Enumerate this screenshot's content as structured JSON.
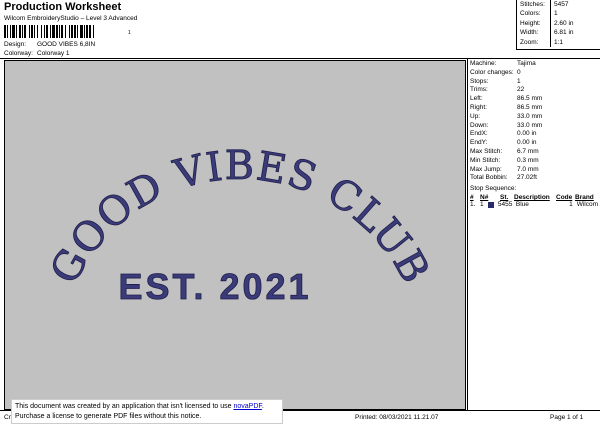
{
  "header": {
    "title": "Production Worksheet",
    "subtitle": "Wilcom EmbroideryStudio – Level 3 Advanced",
    "barcode_number": "1",
    "design_label": "Design:",
    "design_value": "GOOD VIBES 6,8IN",
    "colorway_label": "Colorway:",
    "colorway_value": "Colorway 1"
  },
  "summary": [
    {
      "label": "Stitches:",
      "value": "5457"
    },
    {
      "label": "Colors:",
      "value": "1"
    },
    {
      "label": "Height:",
      "value": "2.60 in"
    },
    {
      "label": "Width:",
      "value": "6.81 in"
    },
    {
      "label": "Zoom:",
      "value": "1:1"
    }
  ],
  "design": {
    "arc_text": "GOOD VIBES CLUB",
    "main_text": "EST. 2021",
    "thread_color": "#3b3b7a"
  },
  "details": [
    {
      "label": "Machine:",
      "value": "Tajima"
    },
    {
      "label": "Color changes:",
      "value": "0"
    },
    {
      "label": "Stops:",
      "value": "1"
    },
    {
      "label": "Trims:",
      "value": "22"
    },
    {
      "label": "Left:",
      "value": "86.5 mm"
    },
    {
      "label": "Right:",
      "value": "86.5 mm"
    },
    {
      "label": "Up:",
      "value": "33.0 mm"
    },
    {
      "label": "Down:",
      "value": "33.0 mm"
    },
    {
      "label": "EndX:",
      "value": "0.00 in"
    },
    {
      "label": "EndY:",
      "value": "0.00 in"
    },
    {
      "label": "Max Stitch:",
      "value": "6.7 mm"
    },
    {
      "label": "Min Stitch:",
      "value": "0.3 mm"
    },
    {
      "label": "Max Jump:",
      "value": "7.0 mm"
    },
    {
      "label": "Total Bobbin:",
      "value": "27.02ft"
    }
  ],
  "stop_sequence": {
    "title": "Stop Sequence:",
    "headers": [
      "#",
      "N#",
      "St.",
      "Description",
      "Code",
      "Brand"
    ],
    "rows": [
      {
        "idx": "1.",
        "num": "1",
        "stitches": "5455",
        "description": "Blue",
        "code": "1",
        "brand": "Wilcom",
        "color": "#2a2a6a"
      }
    ]
  },
  "footer": {
    "left": "Cr",
    "printed": "Printed: 08/03/2021 11.21.07",
    "page": "Page 1 of 1",
    "notice_line1": "This document was created by an application that isn't licensed to use ",
    "notice_link": "novaPDF",
    "notice_line1_end": ".",
    "notice_line2": "Purchase a license to generate PDF files without this notice."
  }
}
